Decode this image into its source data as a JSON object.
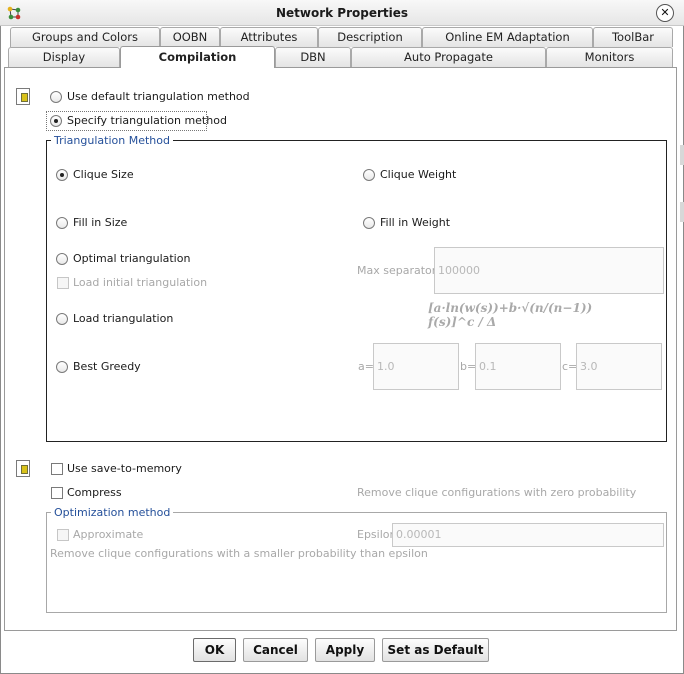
{
  "window": {
    "title": "Network Properties"
  },
  "tabs_row1": [
    {
      "label": "Groups and Colors"
    },
    {
      "label": "OOBN"
    },
    {
      "label": "Attributes"
    },
    {
      "label": "Description"
    },
    {
      "label": "Online EM Adaptation"
    },
    {
      "label": "ToolBar"
    }
  ],
  "tabs_row2": [
    {
      "label": "Display"
    },
    {
      "label": "Compilation"
    },
    {
      "label": "DBN"
    },
    {
      "label": "Auto Propagate"
    },
    {
      "label": "Monitors"
    }
  ],
  "active_tab": "Compilation",
  "triangulation": {
    "use_default_label": "Use default triangulation method",
    "specify_label": "Specify triangulation method",
    "selected": "specify"
  },
  "triangulation_method": {
    "legend": "Triangulation Method",
    "clique_size": "Clique Size",
    "clique_weight": "Clique Weight",
    "fill_in_size": "Fill in Size",
    "fill_in_weight": "Fill in Weight",
    "optimal": "Optimal triangulation",
    "load_initial": "Load initial triangulation",
    "max_separators_label": "Max separators",
    "max_separators_value": "100000",
    "formula": "[a·ln(w(s))+b·√(n/(n−1)) f(s)]^c / Δ",
    "load_triangulation": "Load triangulation",
    "best_greedy": "Best Greedy",
    "a_label": "a=",
    "a_value": "1.0",
    "b_label": "b=",
    "b_value": "0.1",
    "c_label": "c=",
    "c_value": "3.0",
    "selected": "clique_size"
  },
  "memory": {
    "use_save_to_memory": "Use save-to-memory",
    "compress": "Compress",
    "compress_hint": "Remove clique configurations with zero probability"
  },
  "optimization": {
    "legend": "Optimization method",
    "approximate": "Approximate",
    "epsilon_label": "Epsilon",
    "epsilon_value": "0.00001",
    "hint": "Remove clique configurations with a smaller probability than epsilon"
  },
  "buttons": {
    "ok": "OK",
    "cancel": "Cancel",
    "apply": "Apply",
    "set_default": "Set as Default"
  }
}
